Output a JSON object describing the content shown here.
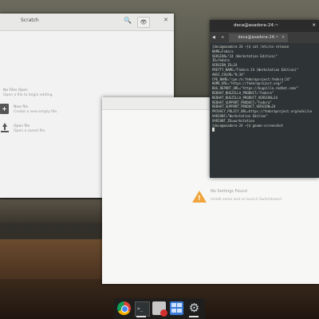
{
  "scratch_window": {
    "title": "Scratch",
    "search_icon": "🔍",
    "eye_icon": "👁",
    "close_icon": "✕",
    "no_files_title": "No Files Open",
    "no_files_sub": "Open a file to begin editing.",
    "new_file_title": "New file",
    "new_file_sub": "Create a new empty file.",
    "open_file_title": "Open file",
    "open_file_sub": "Open a saved file."
  },
  "blank_window": {
    "warning_title": "No Settings Found",
    "warning_sub": "Install some and re-launch Switchboard",
    "warning_mark": "!"
  },
  "terminal": {
    "title": "deca@asadora-24:~",
    "tab_back_icon": "◀",
    "tab_plus_icon": "+",
    "tab_label": "deca@asadora-24:~",
    "tab_close_icon": "✕",
    "close_icon": "✕",
    "lines": [
      "[deca@asadora-24 ~]$ cat /etc/os-release",
      "NAME=Fedora",
      "VERSION=\"24 (Workstation Edition)\"",
      "ID=fedora",
      "VERSION_ID=24",
      "PRETTY_NAME=\"Fedora 24 (Workstation Edition)\"",
      "ANSI_COLOR=\"0;34\"",
      "CPE_NAME=\"cpe:/o:fedoraproject:fedora:24\"",
      "HOME_URL=\"https://fedoraproject.org/\"",
      "BUG_REPORT_URL=\"https://bugzilla.redhat.com/\"",
      "REDHAT_BUGZILLA_PRODUCT=\"Fedora\"",
      "REDHAT_BUGZILLA_PRODUCT_VERSION=24",
      "REDHAT_SUPPORT_PRODUCT=\"Fedora\"",
      "REDHAT_SUPPORT_PRODUCT_VERSION=24",
      "PRIVACY_POLICY_URL=https://fedoraproject.org/wiki/Le",
      "VARIANT=\"Workstation Edition\"",
      "VARIANT_ID=workstation",
      "[deca@asadora-24 ~]$ gnome-screenshot"
    ]
  },
  "dock": {
    "terminal_glyph": ">_",
    "settings_glyph": "⚙"
  },
  "colors": {
    "warning": "#f0a53c",
    "terminal_bg": "#2e3436"
  }
}
